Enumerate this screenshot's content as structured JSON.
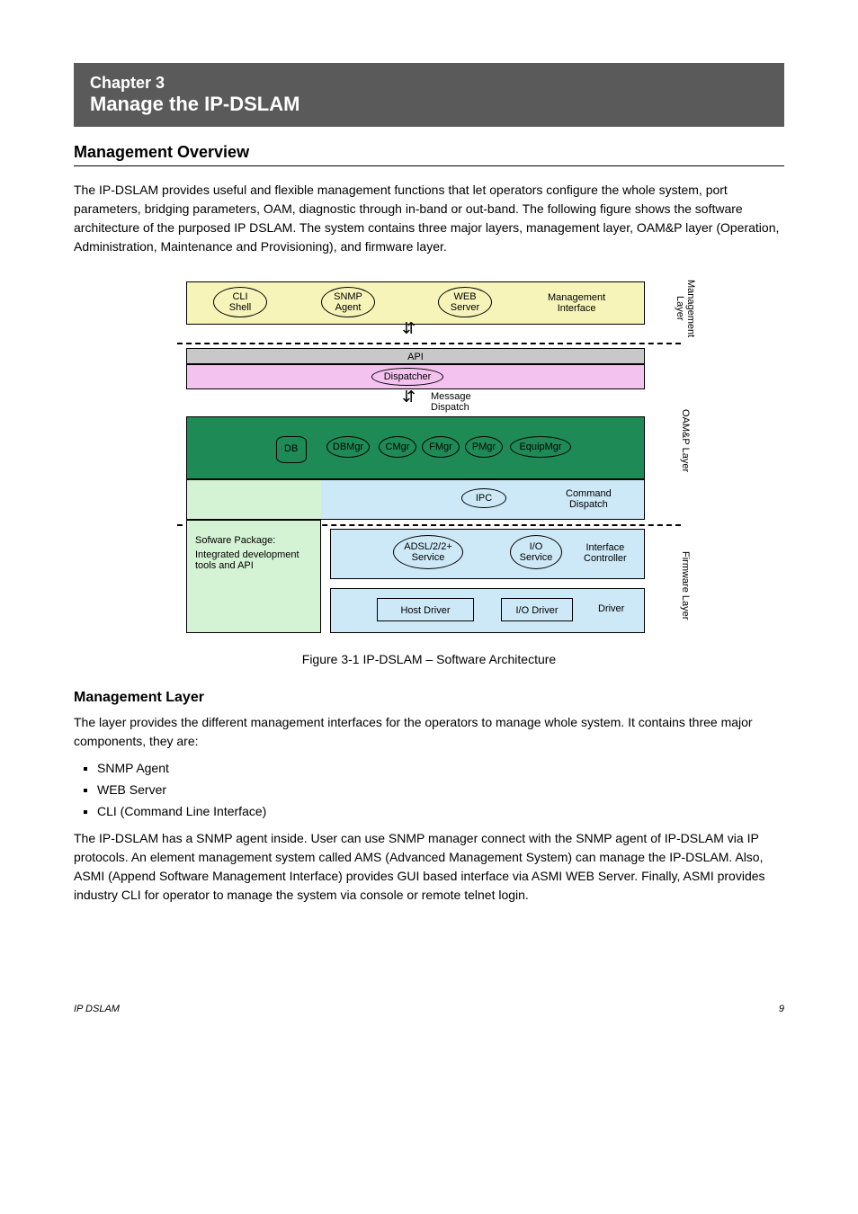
{
  "chapter": {
    "number": "Chapter 3",
    "title": "Manage the IP-DSLAM"
  },
  "section1": {
    "title": "Management Overview",
    "text": "The IP-DSLAM provides useful and flexible management functions that let operators configure the whole system, port parameters, bridging parameters, OAM, diagnostic through in-band or out-band. The following figure shows the software architecture of the purposed IP DSLAM. The system contains three major layers, management layer, OAM&P layer (Operation, Administration, Maintenance and Provisioning), and firmware layer."
  },
  "figure": {
    "mgmt": {
      "cli": "CLI\nShell",
      "snmp": "SNMP\nAgent",
      "web": "WEB\nServer",
      "iface": "Management\nInterface",
      "layer": "Management\nLayer"
    },
    "oamp": {
      "api": "API",
      "dispatcher": "Dispatcher",
      "msg": "Message\nDispatch",
      "db": "DB",
      "dbmgr": "DBMgr",
      "cmgr": "CMgr",
      "fmgr": "FMgr",
      "pmgr": "PMgr",
      "equipmgr": "EquipMgr",
      "ipc": "IPC",
      "cmddisp": "Command\nDispatch",
      "layer": "OAM&P Layer"
    },
    "fw": {
      "pkg1": "Sofware Package:",
      "pkg2": "Integrated development\ntools and API",
      "adsl": "ADSL/2/2+\nService",
      "io": "I/O\nService",
      "ifctrl": "Interface\nController",
      "hostdrv": "Host Driver",
      "iodrv": "I/O Driver",
      "drv": "Driver",
      "layer": "Firmware Layer"
    },
    "caption": "Figure 3-1 IP-DSLAM – Software Architecture"
  },
  "mgmtlayer": {
    "title": "Management Layer",
    "text": "The layer provides the different management interfaces for the operators to manage whole system. It contains three major components, they are:",
    "items": [
      "SNMP Agent",
      "WEB Server",
      "CLI (Command Line Interface)"
    ],
    "para2": "The IP-DSLAM has a SNMP agent inside. User can use SNMP manager connect with the SNMP agent of IP-DSLAM via IP protocols. An element management system called AMS (Advanced Management System) can manage the IP-DSLAM. Also, ASMI (Append Software Management Interface) provides GUI based interface via ASMI WEB Server. Finally, ASMI provides industry CLI for operator to manage the system via console or remote telnet login."
  },
  "footer": {
    "left": "IP DSLAM",
    "right": "9"
  }
}
